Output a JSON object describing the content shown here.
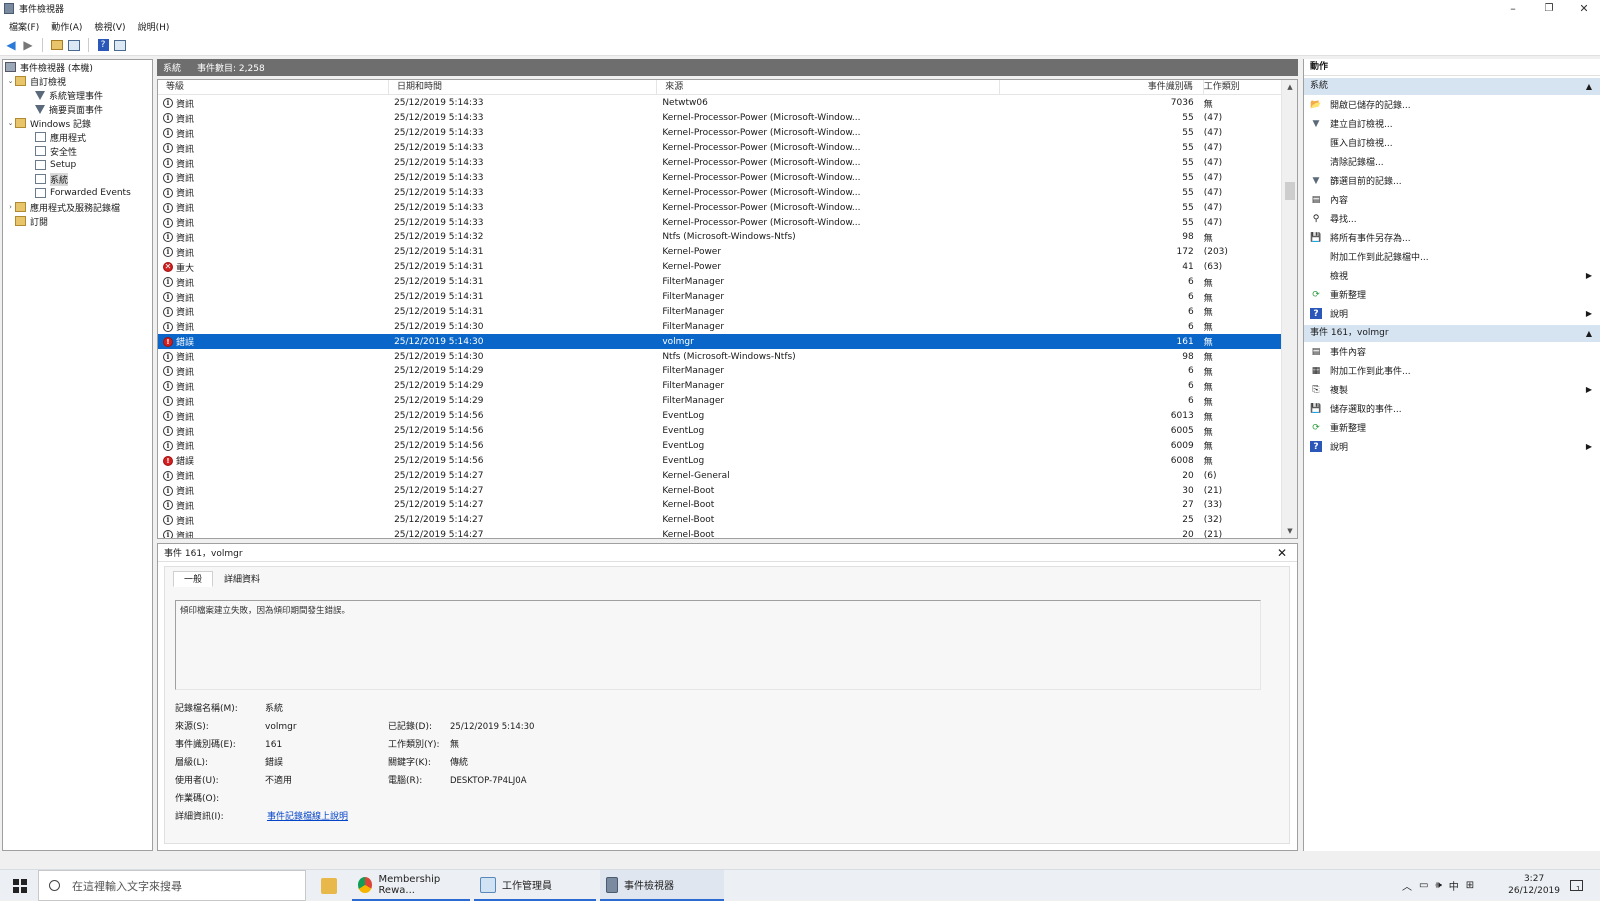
{
  "window": {
    "title": "事件檢視器",
    "minimize": "–",
    "restore": "❐",
    "close": "✕"
  },
  "menu": [
    "檔案(F)",
    "動作(A)",
    "檢視(V)",
    "說明(H)"
  ],
  "tree": {
    "root": "事件檢視器 (本機)",
    "custom_views": "自訂檢視",
    "admin_events": "系統管理事件",
    "summary_events": "摘要頁面事件",
    "windows_logs": "Windows 記錄",
    "application": "應用程式",
    "security": "安全性",
    "setup": "Setup",
    "system": "系統",
    "forwarded": "Forwarded Events",
    "app_service_logs": "應用程式及服務記錄檔",
    "subscriptions": "訂閱"
  },
  "center": {
    "log_name": "系統",
    "event_count": "事件數目: 2,258"
  },
  "grid": {
    "headers": {
      "level": "等級",
      "datetime": "日期和時間",
      "source": "來源",
      "event_id": "事件識別碼",
      "task": "工作類別"
    },
    "rows": [
      {
        "icon": "info",
        "level": "資訊",
        "datetime": "25/12/2019 5:14:33",
        "source": "Netwtw06",
        "event_id": "7036",
        "task": "無"
      },
      {
        "icon": "info",
        "level": "資訊",
        "datetime": "25/12/2019 5:14:33",
        "source": "Kernel-Processor-Power (Microsoft-Window...",
        "event_id": "55",
        "task": "(47)"
      },
      {
        "icon": "info",
        "level": "資訊",
        "datetime": "25/12/2019 5:14:33",
        "source": "Kernel-Processor-Power (Microsoft-Window...",
        "event_id": "55",
        "task": "(47)"
      },
      {
        "icon": "info",
        "level": "資訊",
        "datetime": "25/12/2019 5:14:33",
        "source": "Kernel-Processor-Power (Microsoft-Window...",
        "event_id": "55",
        "task": "(47)"
      },
      {
        "icon": "info",
        "level": "資訊",
        "datetime": "25/12/2019 5:14:33",
        "source": "Kernel-Processor-Power (Microsoft-Window...",
        "event_id": "55",
        "task": "(47)"
      },
      {
        "icon": "info",
        "level": "資訊",
        "datetime": "25/12/2019 5:14:33",
        "source": "Kernel-Processor-Power (Microsoft-Window...",
        "event_id": "55",
        "task": "(47)"
      },
      {
        "icon": "info",
        "level": "資訊",
        "datetime": "25/12/2019 5:14:33",
        "source": "Kernel-Processor-Power (Microsoft-Window...",
        "event_id": "55",
        "task": "(47)"
      },
      {
        "icon": "info",
        "level": "資訊",
        "datetime": "25/12/2019 5:14:33",
        "source": "Kernel-Processor-Power (Microsoft-Window...",
        "event_id": "55",
        "task": "(47)"
      },
      {
        "icon": "info",
        "level": "資訊",
        "datetime": "25/12/2019 5:14:33",
        "source": "Kernel-Processor-Power (Microsoft-Window...",
        "event_id": "55",
        "task": "(47)"
      },
      {
        "icon": "info",
        "level": "資訊",
        "datetime": "25/12/2019 5:14:32",
        "source": "Ntfs (Microsoft-Windows-Ntfs)",
        "event_id": "98",
        "task": "無"
      },
      {
        "icon": "info",
        "level": "資訊",
        "datetime": "25/12/2019 5:14:31",
        "source": "Kernel-Power",
        "event_id": "172",
        "task": "(203)"
      },
      {
        "icon": "crit",
        "level": "重大",
        "datetime": "25/12/2019 5:14:31",
        "source": "Kernel-Power",
        "event_id": "41",
        "task": "(63)"
      },
      {
        "icon": "info",
        "level": "資訊",
        "datetime": "25/12/2019 5:14:31",
        "source": "FilterManager",
        "event_id": "6",
        "task": "無"
      },
      {
        "icon": "info",
        "level": "資訊",
        "datetime": "25/12/2019 5:14:31",
        "source": "FilterManager",
        "event_id": "6",
        "task": "無"
      },
      {
        "icon": "info",
        "level": "資訊",
        "datetime": "25/12/2019 5:14:31",
        "source": "FilterManager",
        "event_id": "6",
        "task": "無"
      },
      {
        "icon": "info",
        "level": "資訊",
        "datetime": "25/12/2019 5:14:30",
        "source": "FilterManager",
        "event_id": "6",
        "task": "無"
      },
      {
        "icon": "err",
        "level": "錯誤",
        "datetime": "25/12/2019 5:14:30",
        "source": "volmgr",
        "event_id": "161",
        "task": "無",
        "selected": true
      },
      {
        "icon": "info",
        "level": "資訊",
        "datetime": "25/12/2019 5:14:30",
        "source": "Ntfs (Microsoft-Windows-Ntfs)",
        "event_id": "98",
        "task": "無"
      },
      {
        "icon": "info",
        "level": "資訊",
        "datetime": "25/12/2019 5:14:29",
        "source": "FilterManager",
        "event_id": "6",
        "task": "無"
      },
      {
        "icon": "info",
        "level": "資訊",
        "datetime": "25/12/2019 5:14:29",
        "source": "FilterManager",
        "event_id": "6",
        "task": "無"
      },
      {
        "icon": "info",
        "level": "資訊",
        "datetime": "25/12/2019 5:14:29",
        "source": "FilterManager",
        "event_id": "6",
        "task": "無"
      },
      {
        "icon": "info",
        "level": "資訊",
        "datetime": "25/12/2019 5:14:56",
        "source": "EventLog",
        "event_id": "6013",
        "task": "無"
      },
      {
        "icon": "info",
        "level": "資訊",
        "datetime": "25/12/2019 5:14:56",
        "source": "EventLog",
        "event_id": "6005",
        "task": "無"
      },
      {
        "icon": "info",
        "level": "資訊",
        "datetime": "25/12/2019 5:14:56",
        "source": "EventLog",
        "event_id": "6009",
        "task": "無"
      },
      {
        "icon": "err",
        "level": "錯誤",
        "datetime": "25/12/2019 5:14:56",
        "source": "EventLog",
        "event_id": "6008",
        "task": "無"
      },
      {
        "icon": "info",
        "level": "資訊",
        "datetime": "25/12/2019 5:14:27",
        "source": "Kernel-General",
        "event_id": "20",
        "task": "(6)"
      },
      {
        "icon": "info",
        "level": "資訊",
        "datetime": "25/12/2019 5:14:27",
        "source": "Kernel-Boot",
        "event_id": "30",
        "task": "(21)"
      },
      {
        "icon": "info",
        "level": "資訊",
        "datetime": "25/12/2019 5:14:27",
        "source": "Kernel-Boot",
        "event_id": "27",
        "task": "(33)"
      },
      {
        "icon": "info",
        "level": "資訊",
        "datetime": "25/12/2019 5:14:27",
        "source": "Kernel-Boot",
        "event_id": "25",
        "task": "(32)"
      },
      {
        "icon": "info",
        "level": "資訊",
        "datetime": "25/12/2019 5:14:27",
        "source": "Kernel-Boot",
        "event_id": "20",
        "task": "(21)"
      }
    ]
  },
  "detail": {
    "title": "事件 161，volmgr",
    "close": "✕",
    "tabs": {
      "general": "一般",
      "details": "詳細資料"
    },
    "message": "傾印檔案建立失敗，因為傾印期間發生錯誤。",
    "props": {
      "log_name_label": "記錄檔名稱(M):",
      "log_name": "系統",
      "source_label": "來源(S):",
      "source": "volmgr",
      "logged_label": "已記錄(D):",
      "logged": "25/12/2019 5:14:30",
      "event_id_label": "事件識別碼(E):",
      "event_id": "161",
      "task_label": "工作類別(Y):",
      "task": "無",
      "level_label": "層級(L):",
      "level": "錯誤",
      "keywords_label": "關鍵字(K):",
      "keywords": "傳統",
      "user_label": "使用者(U):",
      "user": "不適用",
      "computer_label": "電腦(R):",
      "computer": "DESKTOP-7P4LJ0A",
      "opcode_label": "作業碼(O):",
      "more_info_label": "詳細資訊(I):",
      "more_info_link": "事件記錄檔線上說明"
    }
  },
  "actions": {
    "header": "動作",
    "section1": "系統",
    "items1": [
      {
        "icon": "open-log-icon",
        "label": "開啟已儲存的記錄..."
      },
      {
        "icon": "create-view-icon",
        "label": "建立自訂檢視..."
      },
      {
        "icon": "",
        "label": "匯入自訂檢視..."
      },
      {
        "icon": "",
        "label": "清除記錄檔..."
      },
      {
        "icon": "filter-icon",
        "label": "篩選目前的記錄..."
      },
      {
        "icon": "properties-icon",
        "label": "內容"
      },
      {
        "icon": "find-icon",
        "label": "尋找..."
      },
      {
        "icon": "save-icon",
        "label": "將所有事件另存為..."
      },
      {
        "icon": "",
        "label": "附加工作到此記錄檔中..."
      },
      {
        "icon": "",
        "label": "檢視",
        "arrow": true
      },
      {
        "icon": "refresh-icon",
        "label": "重新整理"
      },
      {
        "icon": "help-icon",
        "label": "說明",
        "arrow": true
      }
    ],
    "section2": "事件 161，volmgr",
    "items2": [
      {
        "icon": "event-properties-icon",
        "label": "事件內容"
      },
      {
        "icon": "attach-task-icon",
        "label": "附加工作到此事件..."
      },
      {
        "icon": "copy-icon",
        "label": "複製",
        "arrow": true
      },
      {
        "icon": "save-icon",
        "label": "儲存選取的事件..."
      },
      {
        "icon": "refresh-icon",
        "label": "重新整理"
      },
      {
        "icon": "help-icon",
        "label": "說明",
        "arrow": true
      }
    ]
  },
  "taskbar": {
    "search_placeholder": "在這裡輸入文字來搜尋",
    "apps": [
      {
        "label": "Membership Rewa..."
      },
      {
        "label": "工作管理員"
      },
      {
        "label": "事件檢視器"
      }
    ],
    "ime": "中",
    "time": "3:27",
    "date": "26/12/2019",
    "notif_count": "1"
  },
  "colors": {
    "selection": "#0a66c8",
    "section_bg": "#d6e4f2",
    "header_bar": "#6e6e6e",
    "error": "#d32020"
  }
}
